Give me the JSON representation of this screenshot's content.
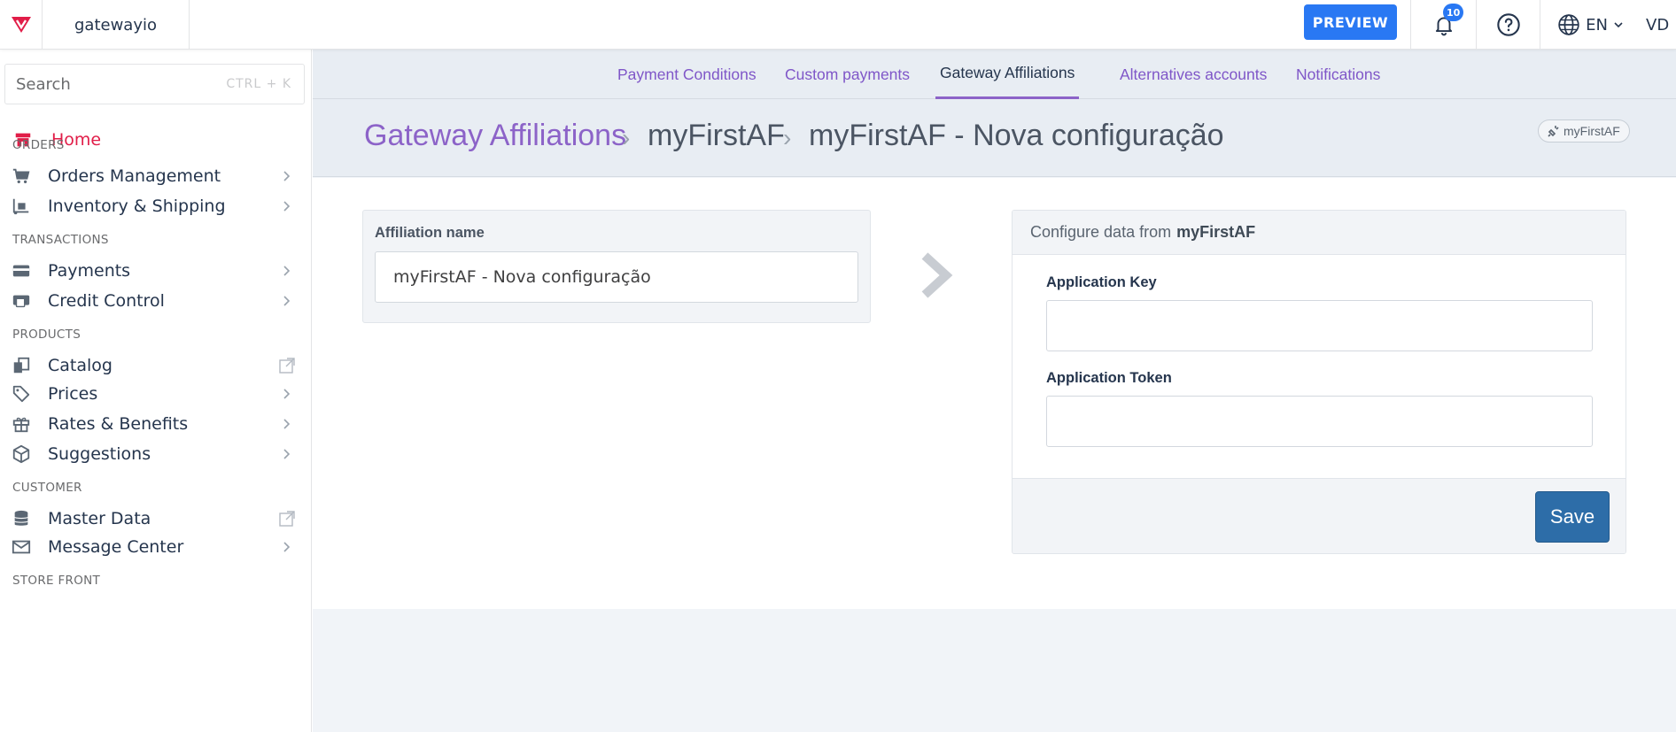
{
  "topbar": {
    "account_name": "gatewayio",
    "preview_label": "PREVIEW",
    "notifications_count": "10",
    "language": "EN",
    "user_initials": "VD"
  },
  "sidebar": {
    "search_placeholder": "Search",
    "search_shortcut": "CTRL + K",
    "home_label": "Home",
    "sections": {
      "orders": "ORDERS",
      "transactions": "TRANSACTIONS",
      "products": "PRODUCTS",
      "customer": "CUSTOMER",
      "store_front": "STORE FRONT"
    },
    "items": {
      "orders_management": "Orders Management",
      "inventory_shipping": "Inventory & Shipping",
      "payments": "Payments",
      "credit_control": "Credit Control",
      "catalog": "Catalog",
      "prices": "Prices",
      "rates_benefits": "Rates & Benefits",
      "suggestions": "Suggestions",
      "master_data": "Master Data",
      "message_center": "Message Center"
    }
  },
  "subnav": {
    "tabs": [
      "Payment Conditions",
      "Custom payments",
      "Gateway Affiliations",
      "Alternatives accounts",
      "Notifications"
    ],
    "active": "Gateway Affiliations"
  },
  "breadcrumb": {
    "level1": "Gateway Affiliations",
    "level2": "myFirstAF",
    "level3": "myFirstAF - Nova configuração",
    "badge": "myFirstAF"
  },
  "form": {
    "affiliation_label": "Affiliation name",
    "affiliation_value": "myFirstAF - Nova configuração",
    "config_prefix": "Configure data from",
    "config_name": "myFirstAF",
    "app_key_label": "Application Key",
    "app_key_value": "",
    "app_token_label": "Application Token",
    "app_token_value": "",
    "save_label": "Save"
  },
  "colors": {
    "brand": "#e11d48",
    "accent_purple": "#8c63c8",
    "primary_blue": "#2978f3",
    "save_blue": "#2d6da8"
  }
}
